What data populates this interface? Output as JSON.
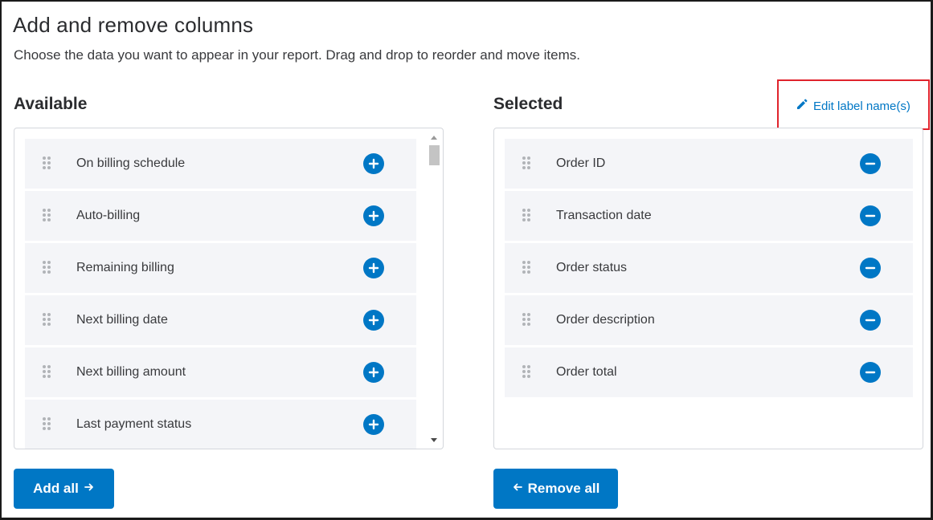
{
  "header": {
    "title": "Add and remove columns",
    "subtitle": "Choose the data you want to appear in your report. Drag and drop to reorder and move items."
  },
  "available": {
    "heading": "Available",
    "items": [
      {
        "label": "On billing schedule"
      },
      {
        "label": "Auto-billing"
      },
      {
        "label": "Remaining billing"
      },
      {
        "label": "Next billing date"
      },
      {
        "label": "Next billing amount"
      },
      {
        "label": "Last payment status"
      }
    ],
    "add_all_label": "Add all",
    "add_all_icon": "arrow-right-icon"
  },
  "selected": {
    "heading": "Selected",
    "edit_label": "Edit label name(s)",
    "edit_icon": "pencil-icon",
    "items": [
      {
        "label": "Order ID"
      },
      {
        "label": "Transaction date"
      },
      {
        "label": "Order status"
      },
      {
        "label": "Order description"
      },
      {
        "label": "Order total"
      }
    ],
    "remove_all_label": "Remove all",
    "remove_all_icon": "arrow-left-icon"
  },
  "colors": {
    "accent": "#0077c5",
    "highlight_box": "#e0232c",
    "row_background": "#f4f5f8"
  }
}
